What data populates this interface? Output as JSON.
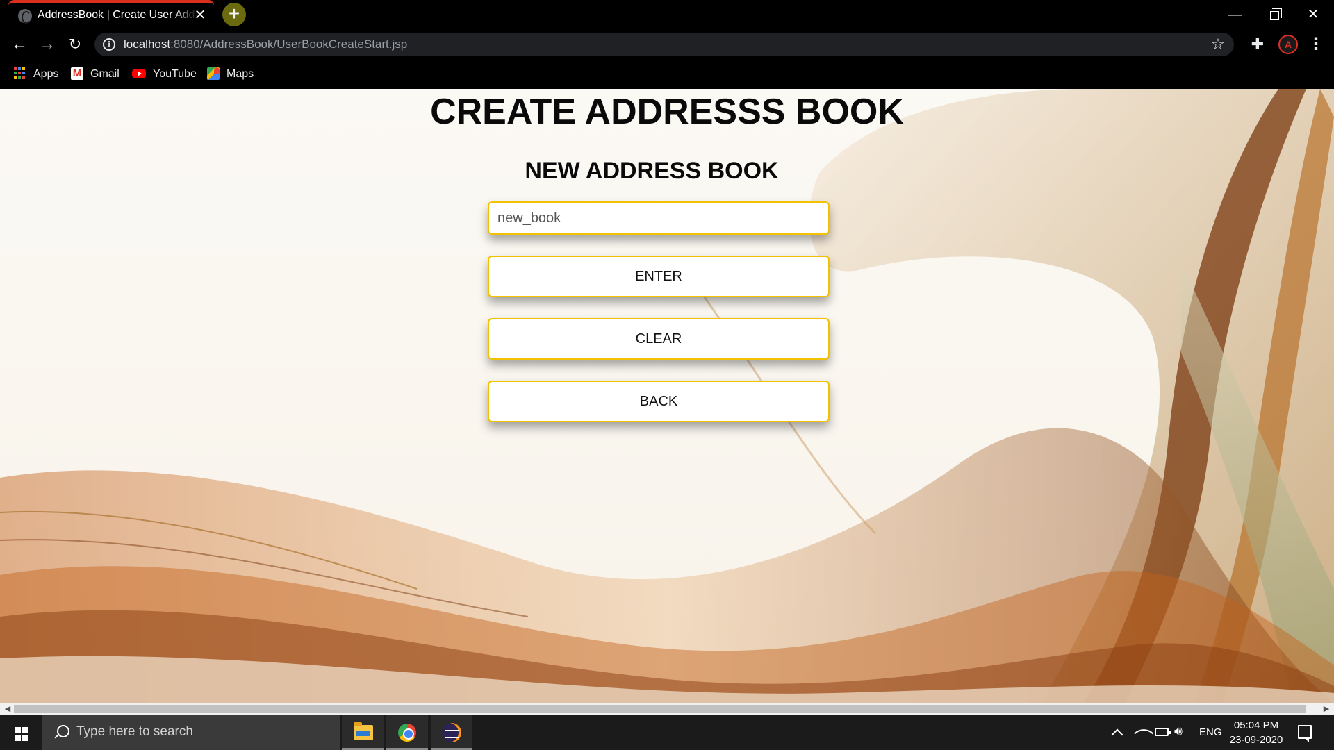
{
  "browser": {
    "tab_title": "AddressBook | Create User Address Book",
    "url_host": "localhost",
    "url_path": ":8080/AddressBook/UserBookCreateStart.jsp",
    "bookmarks": [
      "Apps",
      "Gmail",
      "YouTube",
      "Maps"
    ],
    "profile_initial": "A"
  },
  "page": {
    "title": "CREATE ADDRESSS BOOK",
    "subtitle": "NEW ADDRESS BOOK",
    "name_input_value": "new_book",
    "buttons": {
      "enter": "ENTER",
      "clear": "CLEAR",
      "back": "BACK"
    }
  },
  "taskbar": {
    "search_placeholder": "Type here to search",
    "language": "ENG",
    "time": "05:04 PM",
    "date": "23-09-2020"
  },
  "icons": {
    "new_tab": "plus-icon",
    "close_tab": "close-icon",
    "back": "arrow-left-icon",
    "forward": "arrow-right-icon",
    "reload": "reload-icon",
    "site_info": "info-icon",
    "bookmark": "star-icon",
    "extensions": "puzzle-icon",
    "menu": "kebab-menu-icon"
  },
  "colors": {
    "button_border": "#f2c200",
    "tab_accent": "#d9301e",
    "background_warm": "#c4611a"
  }
}
